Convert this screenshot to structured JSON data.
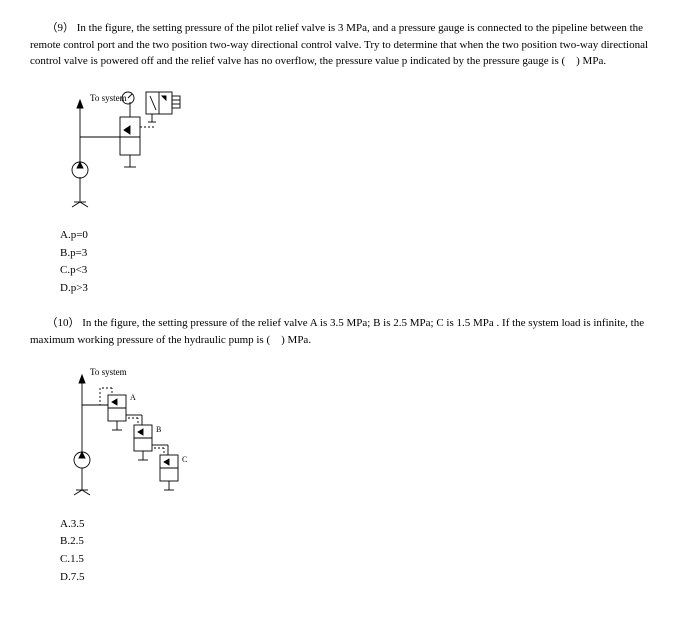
{
  "q9": {
    "number": "（9）",
    "text": "In the figure, the setting pressure of the pilot relief valve is 3 MPa, and a pressure gauge is connected to the pipeline between the remote control port and the two position two-way directional control valve. Try to determine that when the two position two-way directional control valve is powered off and the relief valve has no overflow, the pressure value p indicated by the pressure gauge is ( ) MPa.",
    "fig_label": "To system",
    "options": {
      "a": "A.p=0",
      "b": "B.p=3",
      "c": "C.p<3",
      "d": "D.p>3"
    }
  },
  "q10": {
    "number": "（10）",
    "text": "In the figure, the setting pressure of the relief valve A is 3.5 MPa; B is 2.5 MPa; C is 1.5 MPa . If the system load is infinite, the maximum working pressure of the hydraulic pump is ( ) MPa.",
    "fig_label": "To system",
    "labels": {
      "a": "A",
      "b": "B",
      "c": "C"
    },
    "options": {
      "a": "A.3.5",
      "b": "B.2.5",
      "c": "C.1.5",
      "d": "D.7.5"
    }
  }
}
